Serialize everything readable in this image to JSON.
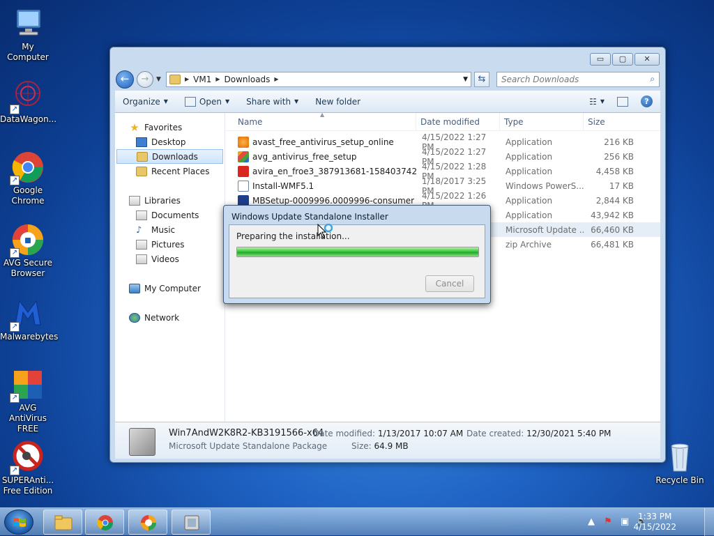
{
  "desktop": {
    "icons": [
      {
        "label": "My Computer"
      },
      {
        "label": "DataWagon..."
      },
      {
        "label": "Google Chrome"
      },
      {
        "label": "AVG Secure Browser"
      },
      {
        "label": "Malwarebytes"
      },
      {
        "label": "AVG AntiVirus FREE"
      },
      {
        "label": "SUPERAnti... Free Edition"
      },
      {
        "label": "Recycle Bin"
      }
    ]
  },
  "explorer": {
    "breadcrumb": [
      "VM1",
      "Downloads"
    ],
    "search_placeholder": "Search Downloads",
    "toolbar": {
      "organize": "Organize",
      "open": "Open",
      "share_with": "Share with",
      "new_folder": "New folder"
    },
    "nav": {
      "favorites": "Favorites",
      "desktop": "Desktop",
      "downloads": "Downloads",
      "recent_places": "Recent Places",
      "libraries": "Libraries",
      "documents": "Documents",
      "music": "Music",
      "pictures": "Pictures",
      "videos": "Videos",
      "my_computer": "My Computer",
      "network": "Network"
    },
    "columns": {
      "name": "Name",
      "date": "Date modified",
      "type": "Type",
      "size": "Size"
    },
    "files": [
      {
        "name": "avast_free_antivirus_setup_online",
        "date": "4/15/2022 1:27 PM",
        "type": "Application",
        "size": "216 KB",
        "icon": "avast-icon"
      },
      {
        "name": "avg_antivirus_free_setup",
        "date": "4/15/2022 1:27 PM",
        "type": "Application",
        "size": "256 KB",
        "icon": "avg-icon"
      },
      {
        "name": "avira_en_froe3_387913681-1584037423__d...",
        "date": "4/15/2022 1:28 PM",
        "type": "Application",
        "size": "4,458 KB",
        "icon": "avira-icon"
      },
      {
        "name": "Install-WMF5.1",
        "date": "1/18/2017 3:25 PM",
        "type": "Windows PowerS...",
        "size": "17 KB",
        "icon": "powershell-script-icon"
      },
      {
        "name": "MBSetup-0009996.0009996-consumer",
        "date": "4/15/2022 1:26 PM",
        "type": "Application",
        "size": "2,844 KB",
        "icon": "malwarebytes-icon"
      },
      {
        "name": "",
        "date": "",
        "type": "Application",
        "size": "43,942 KB",
        "icon": "application-icon"
      },
      {
        "name": "",
        "date": "",
        "type": "Microsoft Update ...",
        "size": "66,460 KB",
        "icon": "update-package-icon"
      },
      {
        "name": "",
        "date": "",
        "type": "zip Archive",
        "size": "66,481 KB",
        "icon": "zip-icon"
      }
    ],
    "details": {
      "name": "Win7AndW2K8R2-KB3191566-x64",
      "kind": "Microsoft Update Standalone Package",
      "date_modified_label": "Date modified:",
      "date_modified": "1/13/2017 10:07 AM",
      "size_label": "Size:",
      "size": "64.9 MB",
      "date_created_label": "Date created:",
      "date_created": "12/30/2021 5:40 PM"
    }
  },
  "dialog": {
    "title": "Windows Update Standalone Installer",
    "status": "Preparing the installation...",
    "progress": 1.0,
    "cancel": "Cancel"
  },
  "taskbar": {
    "time": "1:33 PM",
    "date": "4/15/2022"
  },
  "colors": {
    "desktop_blue": "#1f63c4",
    "progress_green": "#36c83a",
    "selection": "#cfe4fb"
  }
}
